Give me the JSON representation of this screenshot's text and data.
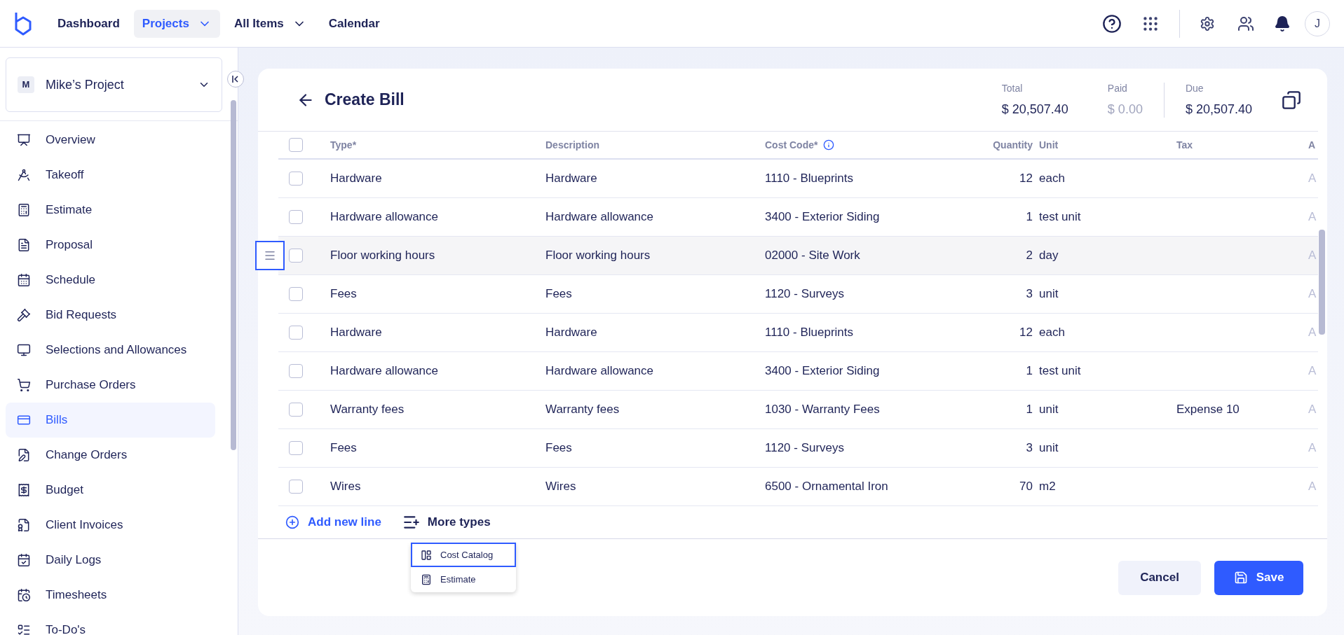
{
  "top_nav": {
    "items": [
      {
        "label": "Dashboard",
        "selected": false,
        "dropdown": false
      },
      {
        "label": "Projects",
        "selected": true,
        "dropdown": true
      },
      {
        "label": "All Items",
        "selected": false,
        "dropdown": true
      },
      {
        "label": "Calendar",
        "selected": false,
        "dropdown": false
      }
    ],
    "avatar": "J"
  },
  "sidebar": {
    "project": {
      "initial": "M",
      "name": "Mike’s Project"
    },
    "items": [
      {
        "label": "Overview",
        "selected": false
      },
      {
        "label": "Takeoff",
        "selected": false
      },
      {
        "label": "Estimate",
        "selected": false
      },
      {
        "label": "Proposal",
        "selected": false
      },
      {
        "label": "Schedule",
        "selected": false
      },
      {
        "label": "Bid Requests",
        "selected": false
      },
      {
        "label": "Selections and Allowances",
        "selected": false
      },
      {
        "label": "Purchase Orders",
        "selected": false
      },
      {
        "label": "Bills",
        "selected": true
      },
      {
        "label": "Change Orders",
        "selected": false
      },
      {
        "label": "Budget",
        "selected": false
      },
      {
        "label": "Client Invoices",
        "selected": false
      },
      {
        "label": "Daily Logs",
        "selected": false
      },
      {
        "label": "Timesheets",
        "selected": false
      },
      {
        "label": "To-Do's",
        "selected": false
      }
    ]
  },
  "page": {
    "title": "Create Bill",
    "totals": [
      {
        "label": "Total",
        "value": "$ 20,507.40",
        "muted": false
      },
      {
        "label": "Paid",
        "value": "$ 0.00",
        "muted": true
      },
      {
        "label": "Due",
        "value": "$ 20,507.40",
        "muted": false
      }
    ]
  },
  "table": {
    "select_all_checked": false,
    "columns": [
      "Type*",
      "Description",
      "Cost Code*",
      "Quantity",
      "Unit",
      "Tax",
      "A"
    ],
    "rows": [
      {
        "checked": false,
        "selected": false,
        "cells": [
          "Hardware",
          "Hardware",
          "1110 - Blueprints",
          "12",
          "each",
          "",
          "A"
        ]
      },
      {
        "checked": false,
        "selected": false,
        "cells": [
          "Hardware allowance",
          "Hardware allowance",
          "3400 - Exterior Siding",
          "1",
          "test unit",
          "",
          "A"
        ]
      },
      {
        "checked": false,
        "selected": true,
        "cells": [
          "Floor working hours",
          "Floor working hours",
          "02000 - Site Work",
          "2",
          "day",
          "",
          "A"
        ]
      },
      {
        "checked": false,
        "selected": false,
        "cells": [
          "Fees",
          "Fees",
          "1120 - Surveys",
          "3",
          "unit",
          "",
          "A"
        ]
      },
      {
        "checked": false,
        "selected": false,
        "cells": [
          "Hardware",
          "Hardware",
          "1110 - Blueprints",
          "12",
          "each",
          "",
          "A"
        ]
      },
      {
        "checked": false,
        "selected": false,
        "cells": [
          "Hardware allowance",
          "Hardware allowance",
          "3400 - Exterior Siding",
          "1",
          "test unit",
          "",
          "A"
        ]
      },
      {
        "checked": false,
        "selected": false,
        "cells": [
          "Warranty fees",
          "Warranty fees",
          "1030 - Warranty Fees",
          "1",
          "unit",
          "Expense 10",
          "A"
        ]
      },
      {
        "checked": false,
        "selected": false,
        "cells": [
          "Fees",
          "Fees",
          "1120 - Surveys",
          "3",
          "unit",
          "",
          "A"
        ]
      },
      {
        "checked": false,
        "selected": false,
        "cells": [
          "Wires",
          "Wires",
          "6500 - Ornamental Iron",
          "70",
          "m2",
          "",
          "A"
        ]
      }
    ]
  },
  "add_line": "Add new line",
  "more_types": "More types",
  "menu": [
    {
      "label": "Cost Catalog",
      "selected": true
    },
    {
      "label": "Estimate",
      "selected": false
    }
  ],
  "buttons": {
    "cancel": "Cancel",
    "save": "Save"
  }
}
